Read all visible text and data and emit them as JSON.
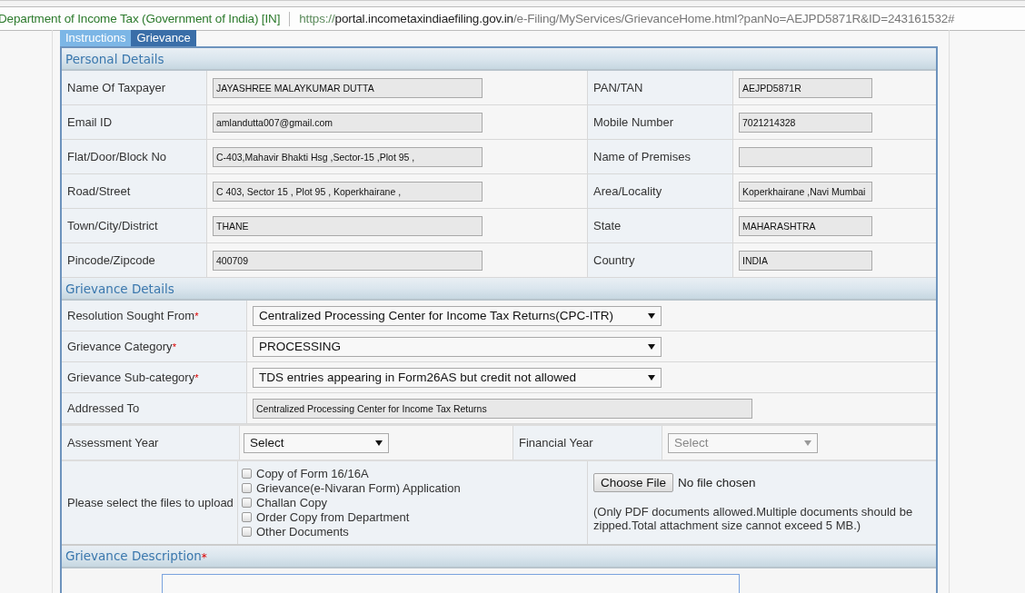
{
  "browser": {
    "site_identity": "Department of Income Tax (Government of India) [IN]",
    "url": {
      "scheme": "https://",
      "host": "portal.incometaxindiaefiling.gov.in",
      "path": "/e-Filing/MyServices/GrievanceHome.html?panNo=AEJPD5871R&ID=243161532#"
    }
  },
  "tabs": [
    {
      "label": "Instructions",
      "selected": false
    },
    {
      "label": "Grievance",
      "selected": true
    }
  ],
  "personal_details": {
    "title": "Personal Details",
    "rows": [
      [
        {
          "label": "Name Of Taxpayer",
          "value": "JAYASHREE MALAYKUMAR DUTTA"
        },
        {
          "label": "PAN/TAN",
          "value": "AEJPD5871R"
        }
      ],
      [
        {
          "label": "Email ID",
          "value": "amlandutta007@gmail.com"
        },
        {
          "label": "Mobile Number",
          "value": "7021214328"
        }
      ],
      [
        {
          "label": "Flat/Door/Block No",
          "value": "C-403,Mahavir Bhakti Hsg ,Sector-15 ,Plot 95 ,"
        },
        {
          "label": "Name of Premises"
        }
      ],
      [
        {
          "label": "Road/Street",
          "value": "C 403, Sector 15 , Plot 95 , Koperkhairane ,"
        },
        {
          "label": "Area/Locality",
          "value": "Koperkhairane ,Navi Mumbai"
        }
      ],
      [
        {
          "label": "Town/City/District",
          "value": "THANE"
        },
        {
          "label": "State",
          "value": "MAHARASHTRA"
        }
      ],
      [
        {
          "label": "Pincode/Zipcode",
          "value": "400709"
        },
        {
          "label": "Country",
          "value": "INDIA"
        }
      ]
    ]
  },
  "grievance_details": {
    "title": "Grievance Details",
    "fields": [
      {
        "label": "Resolution Sought From",
        "required_mark": "*",
        "kind": "select",
        "value": "Centralized Processing Center for Income Tax Returns(CPC-ITR)"
      },
      {
        "label": "Grievance Category",
        "required_mark": "*",
        "kind": "select",
        "value": "PROCESSING"
      },
      {
        "label": "Grievance Sub-category",
        "required_mark": "*",
        "kind": "select",
        "value": "TDS entries appearing in Form26AS but credit not allowed"
      },
      {
        "label": "Addressed To",
        "kind": "text",
        "value": "Centralized Processing Center for Income Tax Returns"
      }
    ],
    "years": [
      {
        "label": "Assessment Year",
        "value": "Select",
        "disabled": false
      },
      {
        "label": "Financial Year",
        "value": "Select",
        "disabled": true
      }
    ],
    "upload": {
      "label": "Please select the files to upload",
      "documents": [
        {
          "label": "Copy of Form 16/16A",
          "checked": false
        },
        {
          "label": "Grievance(e-Nivaran Form) Application",
          "checked": false
        },
        {
          "label": "Challan Copy",
          "checked": false
        },
        {
          "label": "Order Copy from Department",
          "checked": false
        },
        {
          "label": "Other Documents",
          "checked": false
        }
      ],
      "file_button": "Choose File",
      "file_status": "No file chosen",
      "note": "(Only PDF documents allowed.Multiple documents should be zipped.Total attachment size cannot exceed 5 MB.)"
    }
  },
  "grievance_description": {
    "title": "Grievance Description",
    "required_mark": "*"
  }
}
